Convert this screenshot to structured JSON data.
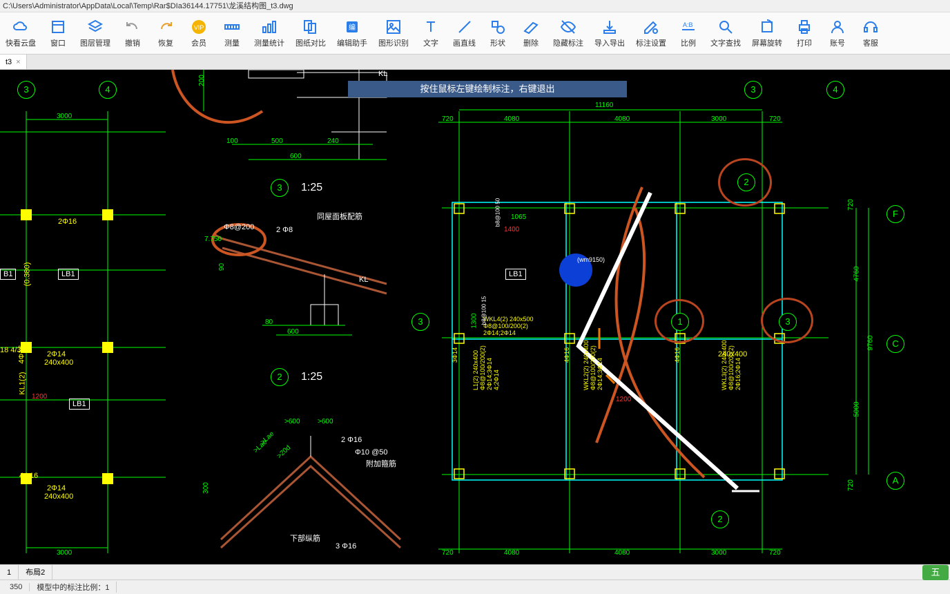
{
  "title_path": "C:\\Users\\Administrator\\AppData\\Local\\Temp\\Rar$DIa36144.17751\\龙溪结构图_t3.dwg",
  "toolbar": [
    {
      "id": "cloud",
      "label": "快看云盘"
    },
    {
      "id": "window",
      "label": "窗口"
    },
    {
      "id": "layers",
      "label": "图层管理"
    },
    {
      "id": "undo",
      "label": "撤销"
    },
    {
      "id": "redo",
      "label": "恢复"
    },
    {
      "id": "vip",
      "label": "会员"
    },
    {
      "id": "measure",
      "label": "测量"
    },
    {
      "id": "measure-stats",
      "label": "测量统计"
    },
    {
      "id": "compare",
      "label": "图纸对比"
    },
    {
      "id": "edit-helper",
      "label": "编辑助手"
    },
    {
      "id": "recognize",
      "label": "图形识别"
    },
    {
      "id": "text",
      "label": "文字"
    },
    {
      "id": "line",
      "label": "画直线"
    },
    {
      "id": "shape",
      "label": "形状"
    },
    {
      "id": "delete",
      "label": "删除"
    },
    {
      "id": "hide-annot",
      "label": "隐藏标注"
    },
    {
      "id": "import-export",
      "label": "导入导出"
    },
    {
      "id": "annot-settings",
      "label": "标注设置"
    },
    {
      "id": "scale",
      "label": "比例"
    },
    {
      "id": "text-search",
      "label": "文字查找"
    },
    {
      "id": "rotate",
      "label": "屏幕旋转"
    },
    {
      "id": "print",
      "label": "打印"
    },
    {
      "id": "account",
      "label": "账号"
    },
    {
      "id": "service",
      "label": "客服"
    }
  ],
  "tab": {
    "name": "t3",
    "close": "×"
  },
  "hint": "按住鼠标左键绘制标注，右键退出",
  "bottom_tabs": [
    "1",
    "布局2"
  ],
  "status": {
    "coord": "350",
    "scale_label": "模型中的标注比例：1"
  },
  "watermark": "五",
  "drawing": {
    "bubbles_left": [
      "3",
      "4"
    ],
    "bubbles_mid": [
      "3",
      "2"
    ],
    "bubbles_right_top": [
      "3",
      "4"
    ],
    "bubbles_right_row2": [
      "2"
    ],
    "bubbles_right_row3": [
      "3",
      "1",
      "3"
    ],
    "bubbles_right_row4": [
      "2"
    ],
    "bubbles_right_side": [
      "F",
      "C",
      "A"
    ],
    "scale_labels": [
      "1:25",
      "1:25"
    ],
    "lb_boxes": [
      "B1",
      "LB1",
      "LB1",
      "LB1"
    ],
    "dims_top_left": "3000",
    "dims_top_right": [
      "720",
      "4080",
      "4080",
      "3000",
      "720"
    ],
    "dim_11160": "11160",
    "dim_500": "500",
    "dim_600": "600",
    "dim_240": "240",
    "dim_100": "100",
    "dim_200_v": "200",
    "dim_7750": "7.750",
    "dim_300": "300",
    "dim_ge600_1": ">600",
    "dim_ge600_2": ">600",
    "dim_ge2d": ">20d",
    "dim_lae1": ">Lae",
    "dim_lae2": ">Lae",
    "dim_4760": "4760",
    "dim_5000": "5000",
    "dim_9760": "9760",
    "dim_720r": "720",
    "dim_720r2": "720",
    "dims_bottom_left": "3000",
    "dims_bottom_right": [
      "720",
      "4080",
      "4080",
      "3000",
      "720"
    ],
    "dim_1065": "1065",
    "dim_1300": "1300",
    "dim_1400": "1400",
    "dim_1200": "1200",
    "dim_80": "80",
    "dim_90": "90",
    "rebar_8_200": "Φ8@200",
    "rebar_2_8": "2 Φ8",
    "rebar_2_16": "2 Φ16",
    "rebar_10_50": "Φ10 @50",
    "rebar_3_16": "3 Φ16",
    "txt_roof": "同屋面板配筋",
    "txt_bottom": "下部纵筋",
    "txt_fujia": "附加箍筋",
    "txt_KL": "KL",
    "txt_KL2": "KL",
    "txt_2414": "2Φ14",
    "txt_240400": "240x400",
    "txt_2416": "2Φ16",
    "txt_0380": "(0.380)",
    "txt_4416": "4Φ16",
    "txt_3414": "3Φ14",
    "txt_240x400a": "240x400",
    "txt_240x400b": "240x400",
    "txt_KL1": "KL1(2)",
    "txt_18_4_3": "18 4/3",
    "beam_spec1": "WKL4(2) 240x500\\nΦ8@100/200(2)\\n2Φ14;2Φ14",
    "beam_spec2": "L1(2) 240x400\\nΦ8@100/200(2)\\n2Φ14;3Φ14\\n4;2Φ14",
    "beam_spec3": "WKL2(2) 240x400\\nΦ8@100/200(2)\\n2Φ14;3Φ14",
    "beam_spec4": "WKL3(2) 240x400\\nΦ8@100/200(2)\\n2Φ16;2Φ14",
    "elev_wm150": "(wm9150)",
    "b8100_50": "b8@100 50",
    "b8100_15": "b8@100 15"
  }
}
